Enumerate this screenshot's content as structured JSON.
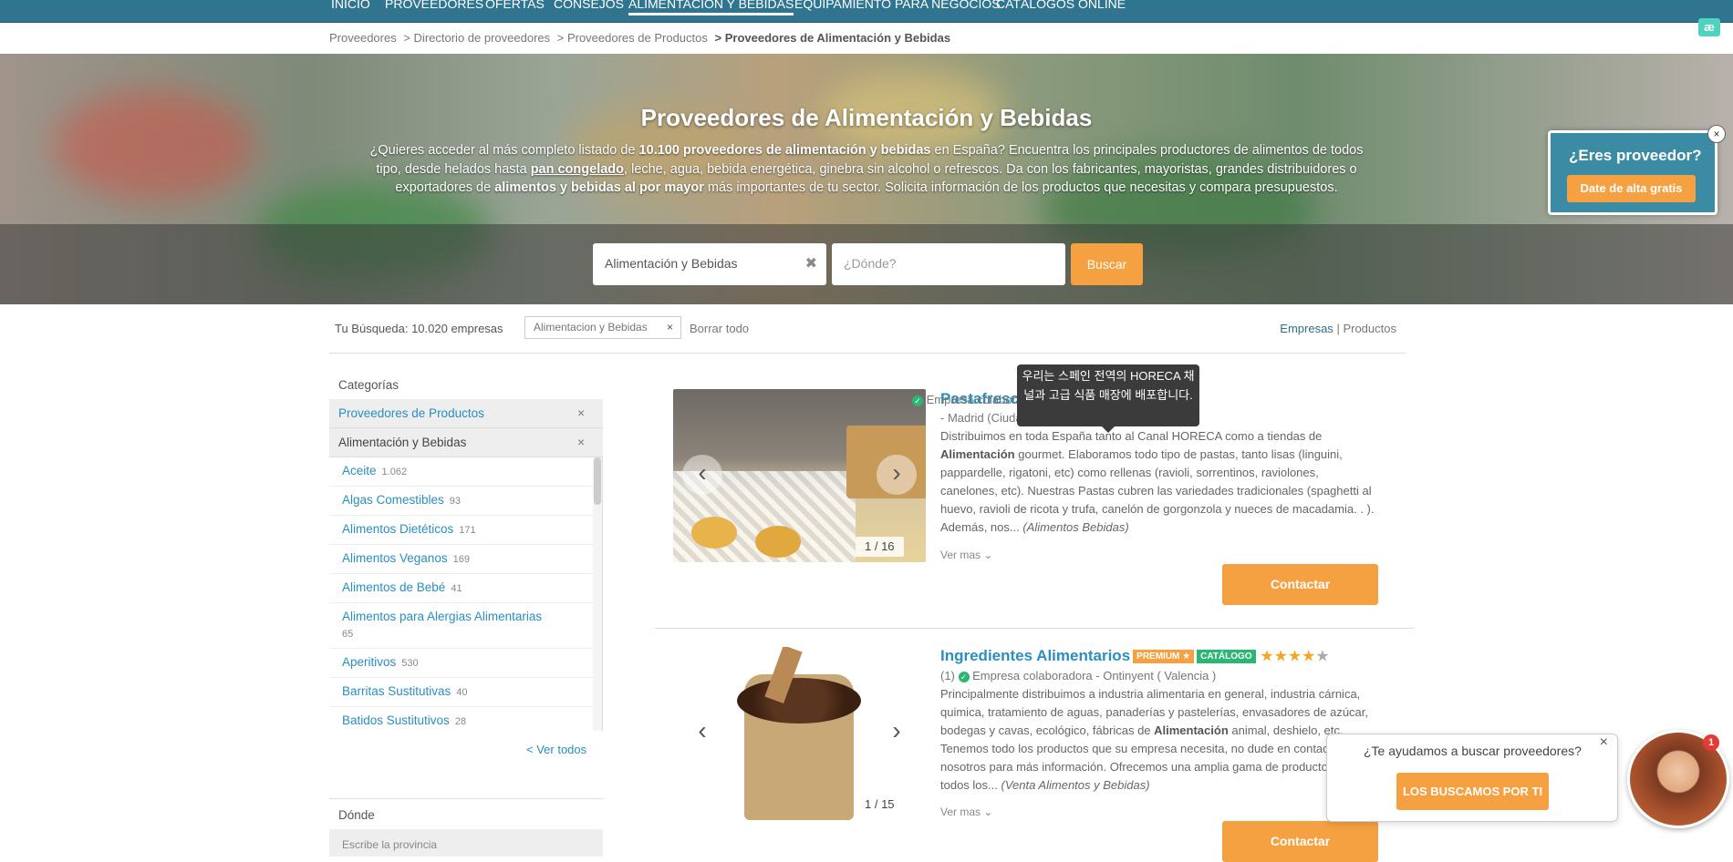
{
  "nav": [
    "INICIO",
    "PROVEEDORES",
    "OFERTAS",
    "CONSEJOS",
    "ALIMENTACIÓN Y BEBIDAS",
    "EQUIPAMIENTO PARA NEGOCIOS",
    "CATÁLOGOS ONLINE"
  ],
  "logo": "æ",
  "breadcrumb": [
    "Proveedores",
    "> Directorio de proveedores",
    "> Proveedores de Productos",
    "> Proveedores de Alimentación y Bebidas"
  ],
  "hero": {
    "title": "Proveedores de Alimentación y Bebidas",
    "d1": "¿Quieres acceder al más completo listado de ",
    "d2": "10.100 proveedores de alimentación y bebidas",
    "d3": " en España? Encuentra los principales productores de alimentos de todos tipo, desde helados hasta ",
    "d4": "pan congelado",
    "d5": ", leche, agua, bebida energética, ginebra sin alcohol o refrescos. Da con los fabricantes, mayoristas, grandes distribuidores o exportadores de ",
    "d6": "alimentos y bebidas al por mayor",
    "d7": " más importantes de tu sector. Solicita información de los productos que necesitas y compara presupuestos."
  },
  "search": {
    "what_value": "Alimentación y Bebidas",
    "where_placeholder": "¿Dónde?",
    "button": "Buscar"
  },
  "provider_box": {
    "title": "¿Eres proveedor?",
    "button": "Date de alta gratis",
    "close": "×"
  },
  "filter": {
    "result": "Tu Búsqueda: 10.020 empresas",
    "chip": "Alimentacion y Bebidas",
    "chip_x": "×",
    "clear": "Borrar todo",
    "tab_empresas": "Empresas",
    "sep": "|",
    "tab_productos": "Productos"
  },
  "sidebar": {
    "heading": "Categorías",
    "cat1": "Proveedores de Productos",
    "cat2": "Alimentación y Bebidas",
    "x": "×",
    "items": [
      {
        "label": "Aceite",
        "count": "1.062"
      },
      {
        "label": "Algas Comestibles",
        "count": "93"
      },
      {
        "label": "Alimentos Dietéticos",
        "count": "171"
      },
      {
        "label": "Alimentos Veganos",
        "count": "169"
      },
      {
        "label": "Alimentos de Bebé",
        "count": "41"
      },
      {
        "label": "Alimentos para Alergias Alimentarias",
        "count": "65"
      },
      {
        "label": "Aperitivos",
        "count": "530"
      },
      {
        "label": "Barritas Sustitutivas",
        "count": "40"
      },
      {
        "label": "Batidos Sustitutivos",
        "count": "28"
      }
    ],
    "ver_todos": "< Ver todos",
    "donde": "Dónde",
    "donde_ph": "Escribe la provincia"
  },
  "tooltip": "우리는 스페인 전역의 HORECA 채널과 고급 식품 매장에 배포합니다.",
  "cards": [
    {
      "title": "Pastafresca",
      "badge_text": "Empresa colaboradora",
      "location": "- Madrid (Ciudad",
      "b1": "Distribuimos en toda España tanto al Canal HORECA como a tiendas de ",
      "b2": "Alimentación",
      "b3": " gourmet. Elaboramos todo tipo de pastas, tanto lisas (linguini, pappardelle, rigatoni, etc) como rellenas (ravioli, sorrentinos, raviolones, canelones, etc). Nuestras Pastas cubren las variedades tradicionales (spaghetti al huevo, ravioli de ricota y trufa, canelón de gorgonzola y nueces de macadamia. . ). Además, nos... ",
      "b4": "(Alimentos Bebidas)",
      "counter": "1 / 16",
      "more": "Ver mas",
      "contact": "Contactar"
    },
    {
      "title": "Ingredientes Alimentarios",
      "premium": "PREMIUM ★",
      "catalogo": "CATÁLOGO",
      "rating": 4,
      "reviews": "(1)",
      "badge_text": "Empresa colaboradora - Ontinyent ( Valencia )",
      "b1": "Principalmente distribuimos a industria alimentaria en general, industria cárnica, quimica, tratamiento de aguas, panaderías y pastelerías, envasadores de azúcar, bodegas y cavas, ecológico, fábricas de ",
      "b2": "Alimentación",
      "b3": " animal, deshielo, etc. Tenemos todo los productos que su empresa necesita, no dude en contactar con nosotros para más información. Ofrecemos una amplia gama de productos en todos los... ",
      "b4": "(Venta Alimentos y Bebidas)",
      "counter": "1 / 15",
      "more": "Ver mas",
      "contact": "Contactar"
    }
  ],
  "help": {
    "question": "¿Te ayudamos a buscar proveedores?",
    "button": "LOS BUSCAMOS POR TI",
    "close": "×",
    "notif": "1"
  }
}
